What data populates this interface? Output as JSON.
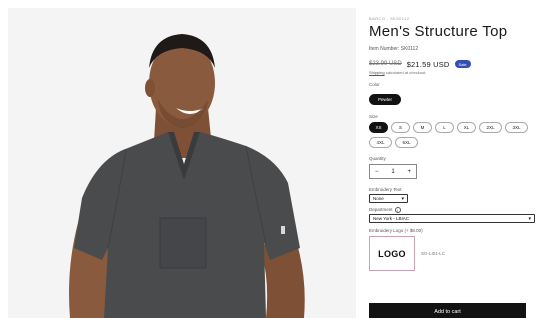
{
  "product": {
    "vendor": "BARCO - SKS0112",
    "title": "Men's Structure Top",
    "item_number": "Item Number: SK0112",
    "price_original": "$23.99 USD",
    "price_sale": "$21.59 USD",
    "sale_badge": "Sale",
    "shipping_link": "Shipping",
    "shipping_rest": " calculated at checkout."
  },
  "color": {
    "label": "Color",
    "options": [
      "Pewter"
    ],
    "selected": "Pewter"
  },
  "size": {
    "label": "Size",
    "options": [
      "XS",
      "S",
      "M",
      "L",
      "XL",
      "2XL",
      "3XL",
      "4XL",
      "5XL"
    ],
    "selected": "XS"
  },
  "quantity": {
    "label": "Quantity",
    "minus": "−",
    "value": "1",
    "plus": "+"
  },
  "embroidery_text": {
    "label": "Embroidery Text",
    "value": "None"
  },
  "department": {
    "label": "Department",
    "value": "New York - LBIAC"
  },
  "embroidery_logo": {
    "label": "Embroidery Logo (+ $8.00)",
    "logo_text": "LOGO",
    "code": "SG-LI01-LC"
  },
  "cart": {
    "add_label": "Add to cart"
  },
  "colors": {
    "sale_badge": "#334fb4",
    "button": "#121212",
    "scrub": "#4a4b4d",
    "skin": "#8a5a3e",
    "logo_border": "#c9a3b4"
  },
  "icons": [
    "info-icon",
    "caret-down-icon"
  ]
}
